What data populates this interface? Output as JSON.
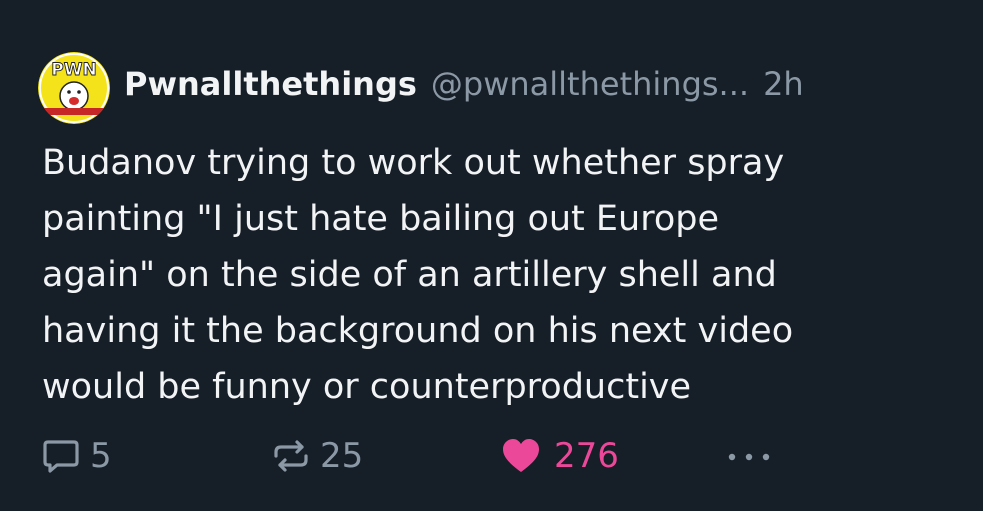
{
  "post": {
    "author": {
      "display_name": "Pwnallthethings",
      "handle": "@pwnallthethings...",
      "avatar_text": "PWN"
    },
    "timestamp": "2h",
    "text": "Budanov trying to work out whether spray\npainting \"I just hate bailing out Europe\nagain\" on the side of an artillery shell and\nhaving it the background on his next video\nwould be funny or counterproductive",
    "actions": {
      "reply": {
        "icon": "reply-icon",
        "count": "5"
      },
      "repost": {
        "icon": "repost-icon",
        "count": "25"
      },
      "like": {
        "icon": "heart-icon",
        "count": "276",
        "active": true
      },
      "more": {
        "icon": "more-icon"
      }
    }
  },
  "colors": {
    "background": "#161e27",
    "text": "#f1f3f5",
    "muted": "#8b98a5",
    "like": "#ec4899"
  }
}
